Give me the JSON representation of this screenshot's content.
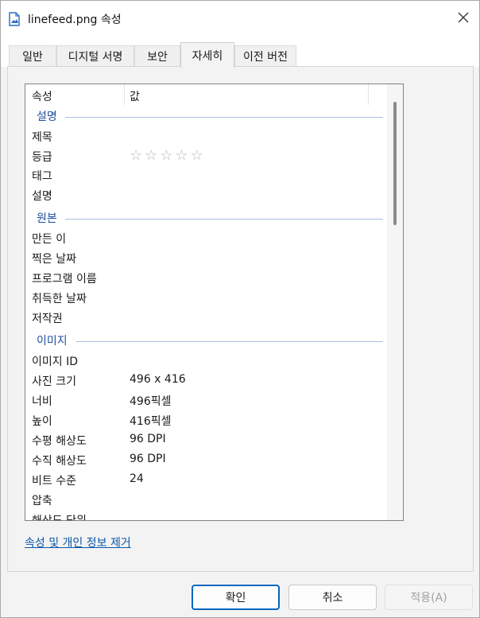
{
  "window": {
    "title": "linefeed.png 속성"
  },
  "tabs": [
    {
      "label": "일반"
    },
    {
      "label": "디지털 서명"
    },
    {
      "label": "보안"
    },
    {
      "label": "자세히"
    },
    {
      "label": "이전 버전"
    }
  ],
  "list": {
    "col_property": "속성",
    "col_value": "값",
    "groups": {
      "description": "설명",
      "origin": "원본",
      "image": "이미지"
    },
    "rows": {
      "title": {
        "prop": "제목",
        "val": ""
      },
      "rating": {
        "prop": "등급",
        "stars": 5,
        "filled": 0
      },
      "tags": {
        "prop": "태그",
        "val": ""
      },
      "comments": {
        "prop": "설명",
        "val": ""
      },
      "authors": {
        "prop": "만든 이",
        "val": ""
      },
      "date_taken": {
        "prop": "찍은 날짜",
        "val": ""
      },
      "program": {
        "prop": "프로그램 이름",
        "val": ""
      },
      "date_acquired": {
        "prop": "취득한 날짜",
        "val": ""
      },
      "copyright": {
        "prop": "저작권",
        "val": ""
      },
      "image_id": {
        "prop": "이미지 ID",
        "val": ""
      },
      "dimensions": {
        "prop": "사진 크기",
        "val": "496 x 416"
      },
      "width": {
        "prop": "너비",
        "val": "496픽셀"
      },
      "height": {
        "prop": "높이",
        "val": "416픽셀"
      },
      "h_res": {
        "prop": "수평 해상도",
        "val": "96 DPI"
      },
      "v_res": {
        "prop": "수직 해상도",
        "val": "96 DPI"
      },
      "bit_depth": {
        "prop": "비트 수준",
        "val": "24"
      },
      "compression": {
        "prop": "압축",
        "val": ""
      },
      "res_unit": {
        "prop": "해상도 단위",
        "val": ""
      }
    }
  },
  "remove_link": "속성 및 개인 정보 제거",
  "buttons": {
    "ok": "확인",
    "cancel": "취소",
    "apply": "적용(A)"
  },
  "colors": {
    "accent": "#0067c0",
    "group_label": "#1f4e9c",
    "link": "#0a58a8"
  }
}
